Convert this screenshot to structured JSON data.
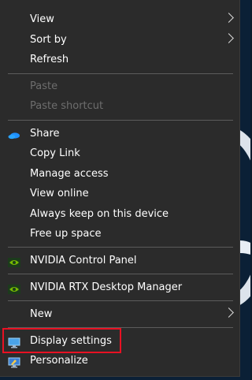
{
  "menu": {
    "items": [
      {
        "label": "View",
        "submenu": true,
        "disabled": false
      },
      {
        "label": "Sort by",
        "submenu": true,
        "disabled": false
      },
      {
        "label": "Refresh",
        "submenu": false,
        "disabled": false
      },
      {
        "label": "Paste",
        "submenu": false,
        "disabled": true
      },
      {
        "label": "Paste shortcut",
        "submenu": false,
        "disabled": true
      },
      {
        "label": "Share",
        "icon": "onedrive-cloud-icon",
        "submenu": false,
        "disabled": false
      },
      {
        "label": "Copy Link",
        "submenu": false,
        "disabled": false
      },
      {
        "label": "Manage access",
        "submenu": false,
        "disabled": false
      },
      {
        "label": "View online",
        "submenu": false,
        "disabled": false
      },
      {
        "label": "Always keep on this device",
        "submenu": false,
        "disabled": false
      },
      {
        "label": "Free up space",
        "submenu": false,
        "disabled": false
      },
      {
        "label": "NVIDIA Control Panel",
        "icon": "nvidia-icon",
        "submenu": false,
        "disabled": false
      },
      {
        "label": "NVIDIA RTX Desktop Manager",
        "icon": "nvidia-icon",
        "submenu": false,
        "disabled": false
      },
      {
        "label": "New",
        "submenu": true,
        "disabled": false
      },
      {
        "label": "Display settings",
        "icon": "display-icon",
        "submenu": false,
        "disabled": false
      },
      {
        "label": "Personalize",
        "icon": "personalize-icon",
        "submenu": false,
        "disabled": false
      }
    ]
  },
  "colors": {
    "menu_bg": "#2b2b2b",
    "text": "#ffffff",
    "disabled_text": "#6d6d6d",
    "highlight_border": "#e81123",
    "onedrive_blue": "#1e90ff",
    "nvidia_green": "#76b900"
  }
}
